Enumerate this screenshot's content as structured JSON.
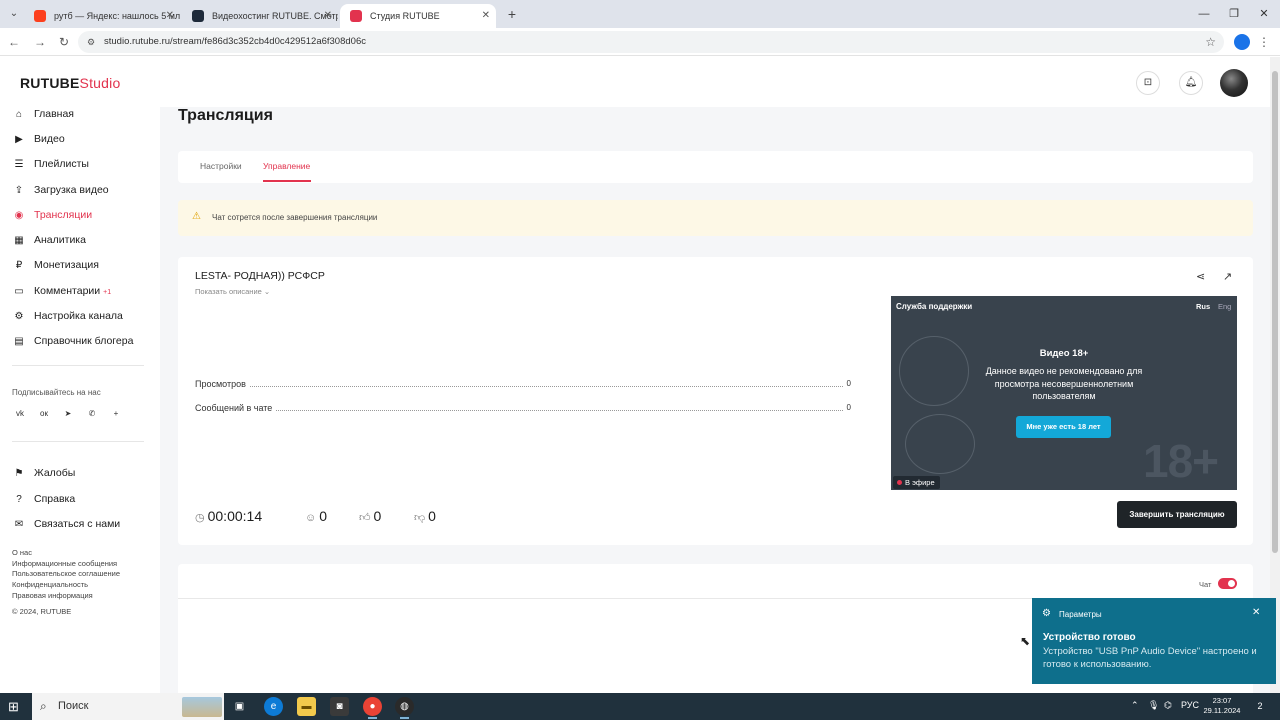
{
  "browser": {
    "tabs": [
      {
        "title": "рутб — Яндекс: нашлось 5 млн",
        "favicon_color": "#fc3f1d",
        "active": false
      },
      {
        "title": "Видеохостинг RUTUBE. Смотрите",
        "favicon_color": "#1e2a3a",
        "active": false
      },
      {
        "title": "Студия RUTUBE",
        "favicon_color": "#e2334e",
        "active": true
      }
    ],
    "url": "studio.rutube.ru/stream/fe86d3c352cb4d0c429512a6f308d06c"
  },
  "logo": {
    "brand": "RUTUBE",
    "product": "Studio"
  },
  "sidebar": {
    "items": [
      {
        "label": "Главная",
        "icon": "home-icon",
        "glyph": "⌂"
      },
      {
        "label": "Видео",
        "icon": "video-icon",
        "glyph": "▶"
      },
      {
        "label": "Плейлисты",
        "icon": "playlist-icon",
        "glyph": "☰"
      },
      {
        "label": "Загрузка видео",
        "icon": "upload-icon",
        "glyph": "⇪"
      },
      {
        "label": "Трансляции",
        "icon": "broadcast-icon",
        "glyph": "◉",
        "active": true
      },
      {
        "label": "Аналитика",
        "icon": "analytics-icon",
        "glyph": "▦"
      },
      {
        "label": "Монетизация",
        "icon": "money-icon",
        "glyph": "₽"
      },
      {
        "label": "Комментарии",
        "icon": "comments-icon",
        "glyph": "▭",
        "badge": "+1"
      },
      {
        "label": "Настройка канала",
        "icon": "settings-icon",
        "glyph": "⚙"
      },
      {
        "label": "Справочник блогера",
        "icon": "guide-icon",
        "glyph": "▤"
      }
    ],
    "subscribe_label": "Подписывайтесь на нас",
    "socials": [
      {
        "icon": "vk-icon",
        "glyph": "vk"
      },
      {
        "icon": "ok-icon",
        "glyph": "ок"
      },
      {
        "icon": "telegram-icon",
        "glyph": "➤"
      },
      {
        "icon": "viber-icon",
        "glyph": "✆"
      },
      {
        "icon": "plus-icon",
        "glyph": "+"
      }
    ],
    "secondary": [
      {
        "label": "Жалобы",
        "icon": "flag-icon",
        "glyph": "⚑"
      },
      {
        "label": "Справка",
        "icon": "help-icon",
        "glyph": "?"
      },
      {
        "label": "Связаться с нами",
        "icon": "mail-icon",
        "glyph": "✉"
      }
    ],
    "footer_links": [
      "О нас",
      "Информационные сообщения",
      "Пользовательское соглашение",
      "Конфиденциальность",
      "Правовая информация"
    ],
    "copyright": "© 2024, RUTUBE"
  },
  "page": {
    "title": "Трансляция",
    "tabs": [
      "Настройки",
      "Управление"
    ],
    "warning": "Чат сотрется после завершения трансляции"
  },
  "stream": {
    "title": "LESTA- РОДНАЯ)) РСФСР",
    "show_description": "Показать описание",
    "stats": [
      {
        "label": "Просмотров",
        "value": "0"
      },
      {
        "label": "Сообщений в чате",
        "value": "0"
      }
    ],
    "timer": "00:00:14",
    "viewers": "0",
    "likes": "0",
    "dislikes": "0",
    "end_button": "Завершить трансляцию"
  },
  "player": {
    "support": "Служба поддержки",
    "lang_rus": "Rus",
    "lang_eng": "Eng",
    "heading": "Видео 18+",
    "text": "Данное видео не рекомендовано для просмотра несовершеннолетним пользователям",
    "confirm_button": "Мне уже есть 18 лет",
    "age_mark": "18+",
    "live_badge": "В эфире"
  },
  "chat": {
    "label": "Чат",
    "enabled": true
  },
  "toast": {
    "app": "Параметры",
    "title": "Устройство готово",
    "body": "Устройство \"USB PnP Audio Device\" настроено и готово к использованию."
  },
  "taskbar": {
    "search_placeholder": "Поиск",
    "lang": "РУС",
    "time": "23:07",
    "date": "29.11.2024",
    "notifications": "2"
  },
  "colors": {
    "accent": "#e2334e",
    "player_bg": "#39434d",
    "confirm_blue": "#13a8d8",
    "toast_bg": "#0e6f8c"
  }
}
